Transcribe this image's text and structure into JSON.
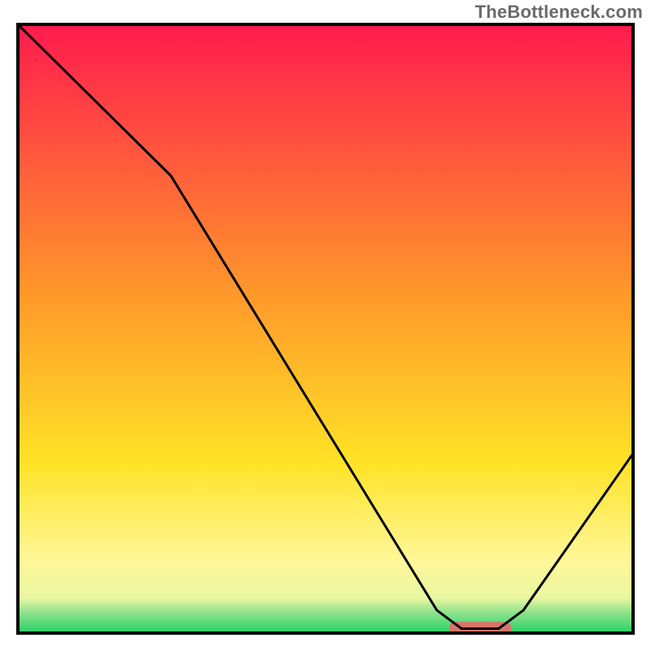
{
  "watermark": "TheBottleneck.com",
  "chart_data": {
    "type": "line",
    "title": "",
    "xlabel": "",
    "ylabel": "",
    "xlim": [
      0,
      100
    ],
    "ylim": [
      0,
      100
    ],
    "grid": false,
    "series": [
      {
        "name": "bottleneck-curve",
        "color": "#000000",
        "x": [
          0,
          25,
          68,
          72,
          78,
          82,
          100
        ],
        "values": [
          100,
          75,
          4,
          1,
          1,
          4,
          30
        ]
      }
    ],
    "marker": {
      "name": "optimal-range-marker",
      "color": "#d9746b",
      "x_start": 70,
      "x_end": 80,
      "y": 1,
      "width": 2.2
    },
    "background_gradient": {
      "stops": [
        {
          "offset": 0.0,
          "color": "#ff1a4e"
        },
        {
          "offset": 0.45,
          "color": "#ff9a2a"
        },
        {
          "offset": 0.72,
          "color": "#ffe326"
        },
        {
          "offset": 0.88,
          "color": "#fff79a"
        },
        {
          "offset": 0.94,
          "color": "#e9f7a0"
        },
        {
          "offset": 0.965,
          "color": "#8be28b"
        },
        {
          "offset": 1.0,
          "color": "#1ecf63"
        }
      ]
    }
  }
}
